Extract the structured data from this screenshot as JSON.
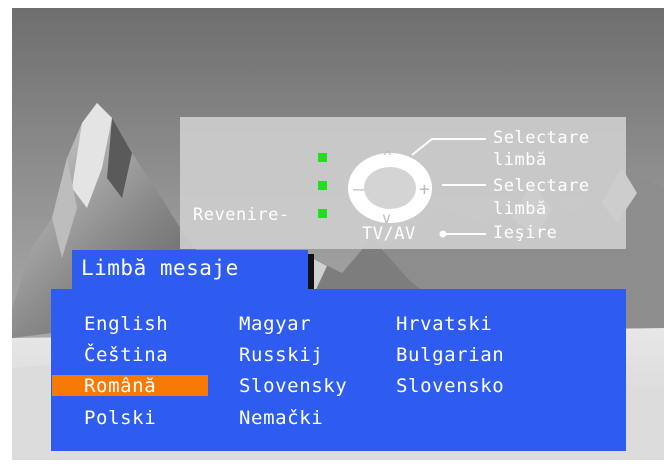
{
  "remote": {
    "back_label": "Revenire-",
    "select_up_label_1": "Selectare",
    "select_up_label_2": "limbă",
    "select_right_label_1": "Selectare",
    "select_right_label_2": "limbă",
    "tvav_label": "TV/AV",
    "exit_label": "Ieşire"
  },
  "menu": {
    "title": "Limbă mesaje",
    "selected": "Română",
    "columns": [
      [
        "English",
        "Čeština",
        "Română",
        "Polski"
      ],
      [
        "Magyar",
        "Russkij",
        "Slovensky",
        "Nemački"
      ],
      [
        "Hrvatski",
        "Bulgarian",
        "Slovensko"
      ]
    ]
  },
  "colors": {
    "menu_bg": "#2f5cf0",
    "highlight": "#f77a06",
    "indicator": "#22dd22"
  }
}
